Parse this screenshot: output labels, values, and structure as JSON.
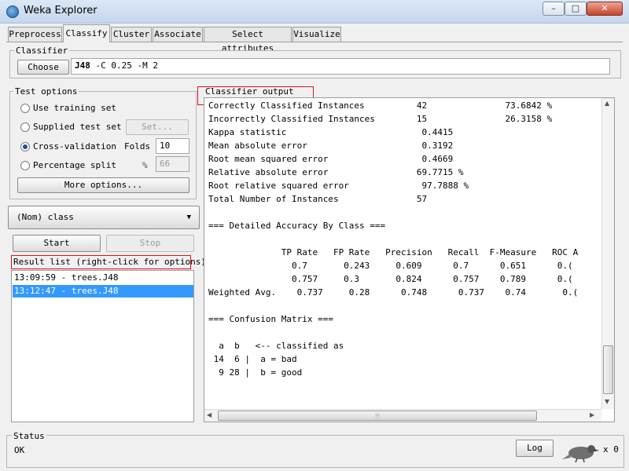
{
  "window": {
    "title": "Weka Explorer",
    "min": "–",
    "max": "□",
    "close": "✕"
  },
  "tabs": [
    "Preprocess",
    "Classify",
    "Cluster",
    "Associate",
    "Select attributes",
    "Visualize"
  ],
  "classifier": {
    "section_label": "Classifier",
    "choose_label": "Choose",
    "name": "J48",
    "options": "-C 0.25 -M 2"
  },
  "test_options": {
    "label": "Test options",
    "use_training": "Use training set",
    "supplied": "Supplied test set",
    "set_label": "Set...",
    "cv": "Cross-validation",
    "folds_label": "Folds",
    "folds_value": "10",
    "pct": "Percentage split",
    "pct_sym": "%",
    "pct_value": "66",
    "more_options": "More options..."
  },
  "class_select": "(Nom) class",
  "start_label": "Start",
  "stop_label": "Stop",
  "result_list": {
    "label": "Result list (right-click for options)",
    "items": [
      "13:09:59 - trees.J48",
      "13:12:47 - trees.J48"
    ]
  },
  "output": {
    "label": "Classifier output",
    "lines": [
      "Correctly Classified Instances          42               73.6842 %",
      "Incorrectly Classified Instances        15               26.3158 %",
      "Kappa statistic                          0.4415",
      "Mean absolute error                      0.3192",
      "Root mean squared error                  0.4669",
      "Relative absolute error                 69.7715 %",
      "Root relative squared error              97.7888 %",
      "Total Number of Instances               57",
      "",
      "=== Detailed Accuracy By Class ===",
      "",
      "              TP Rate   FP Rate   Precision   Recall  F-Measure   ROC A",
      "                0.7       0.243     0.609      0.7      0.651      0.(",
      "                0.757     0.3       0.824      0.757    0.789      0.(",
      "Weighted Avg.    0.737     0.28      0.748      0.737    0.74       0.(",
      "",
      "=== Confusion Matrix ===",
      "",
      "  a  b   <-- classified as",
      " 14  6 |  a = bad",
      "  9 28 |  b = good"
    ]
  },
  "status": {
    "label": "Status",
    "text": "OK",
    "log_label": "Log",
    "count": "x 0"
  }
}
